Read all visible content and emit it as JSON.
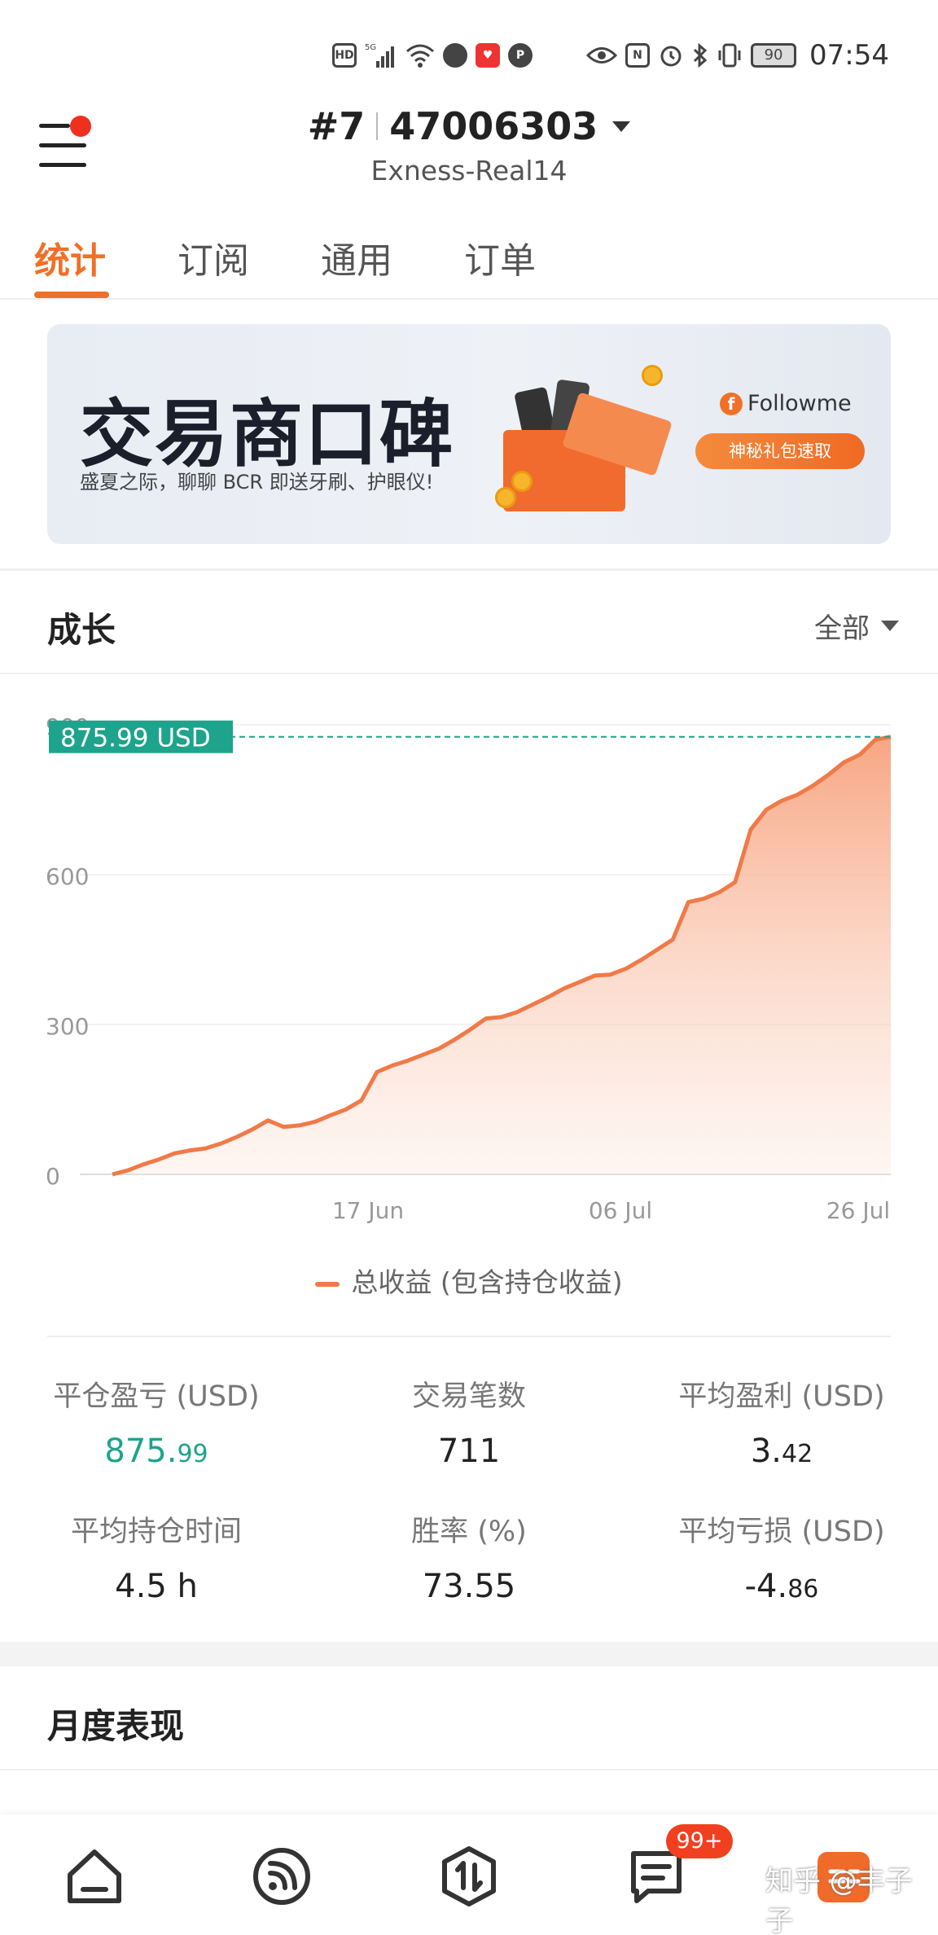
{
  "status_bar": {
    "time": "07:54",
    "battery": "90",
    "icons": [
      "hd-icon",
      "5g-signal-icon",
      "wifi-icon",
      "app-icon",
      "app-icon",
      "parking-icon",
      "eye-icon",
      "nfc-icon",
      "alarm-icon",
      "bluetooth-icon",
      "vibrate-icon",
      "battery-icon"
    ]
  },
  "header": {
    "account_prefix": "#7",
    "account_number": "47006303",
    "server": "Exness-Real14"
  },
  "tabs": [
    {
      "label": "统计",
      "active": true
    },
    {
      "label": "订阅",
      "active": false
    },
    {
      "label": "通用",
      "active": false
    },
    {
      "label": "订单",
      "active": false
    }
  ],
  "banner": {
    "title": "交易商口碑",
    "subtitle": "盛夏之际，聊聊 BCR 即送牙刷、护眼仪!",
    "brand": "Followme",
    "cta": "神秘礼包速取"
  },
  "growth": {
    "title": "成长",
    "filter": "全部"
  },
  "chart_data": {
    "type": "area",
    "current_value_label": "875.99 USD",
    "current_value": 875.99,
    "y_ticks": [
      "0",
      "300",
      "600",
      "900"
    ],
    "ylim": [
      0,
      900
    ],
    "x_ticks": [
      "17 Jun",
      "06 Jul",
      "26 Jul"
    ],
    "legend": "总收益 (包含持仓收益)",
    "series": [
      {
        "name": "总收益 (包含持仓收益)",
        "values": [
          0,
          8,
          20,
          30,
          42,
          48,
          52,
          62,
          75,
          90,
          108,
          95,
          98,
          105,
          118,
          130,
          148,
          205,
          218,
          228,
          240,
          252,
          270,
          290,
          312,
          315,
          325,
          340,
          355,
          372,
          385,
          398,
          400,
          412,
          430,
          450,
          470,
          545,
          552,
          565,
          585,
          690,
          730,
          748,
          760,
          778,
          800,
          825,
          840,
          870,
          876
        ]
      }
    ],
    "grid": true,
    "color": "#f07a48",
    "reference_line_color": "#1ea38c"
  },
  "stats": [
    {
      "label": "平仓盈亏 (USD)",
      "int": "875.",
      "dec": "99",
      "green": true
    },
    {
      "label": "交易笔数",
      "int": "711",
      "dec": "",
      "green": false
    },
    {
      "label": "平均盈利 (USD)",
      "int": "3.",
      "dec": "42",
      "green": false
    },
    {
      "label": "平均持仓时间",
      "int": "4.5 h",
      "dec": "",
      "green": false
    },
    {
      "label": "胜率 (%)",
      "int": "73.55",
      "dec": "",
      "green": false
    },
    {
      "label": "平均亏损 (USD)",
      "int": "-4.",
      "dec": "86",
      "green": false
    }
  ],
  "monthly": {
    "title": "月度表现"
  },
  "bottom_nav": {
    "items": [
      "home-icon",
      "feed-icon",
      "trade-icon",
      "messages-icon",
      "profile-icon"
    ],
    "badge": "99+"
  },
  "watermark": "知乎 @丰子子",
  "colors": {
    "accent": "#f07028",
    "positive": "#1ea38c"
  }
}
